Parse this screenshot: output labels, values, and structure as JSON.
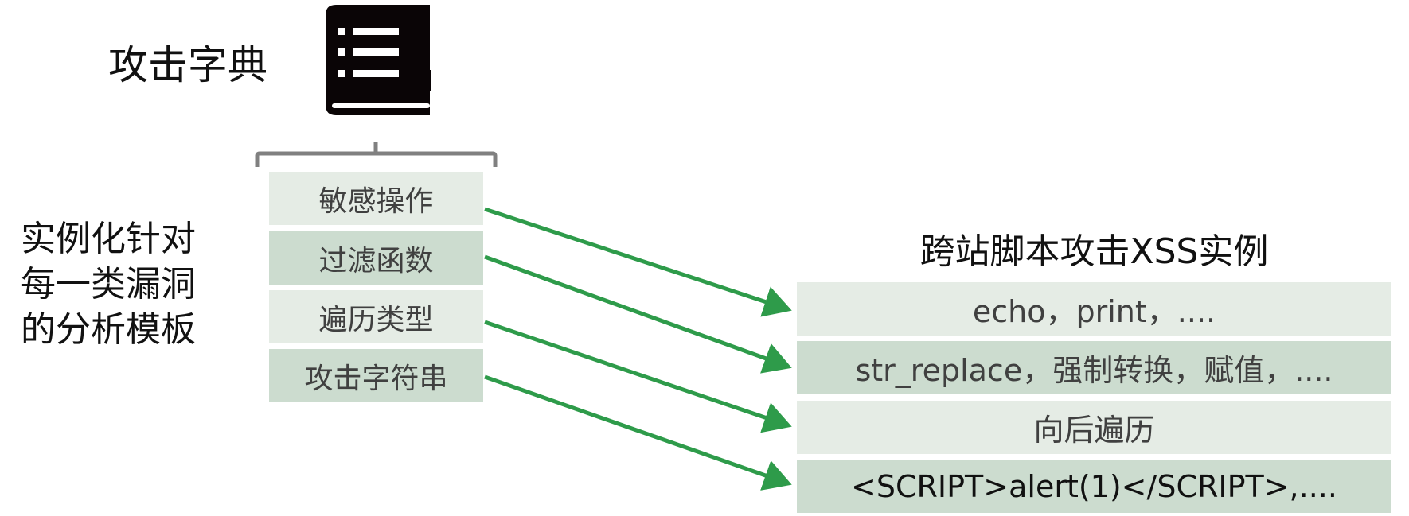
{
  "dictionary": {
    "title": "攻击字典",
    "icon": "book-index-icon"
  },
  "side_label": [
    "实例化针对",
    "每一类漏洞",
    "的分析模板"
  ],
  "template_items": [
    "敏感操作",
    "过滤函数",
    "遍历类型",
    "攻击字符串"
  ],
  "instance": {
    "title": "跨站脚本攻击XSS实例",
    "items": [
      "echo，print，....",
      "str_replace，强制转换，赋值，....",
      "向后遍历",
      "<SCRIPT>alert(1)</SCRIPT>,...."
    ]
  },
  "colors": {
    "arrow": "#2e9b4a",
    "light_row": "#e5ece5",
    "dark_row": "#ccdccf",
    "bracket": "#808080"
  }
}
